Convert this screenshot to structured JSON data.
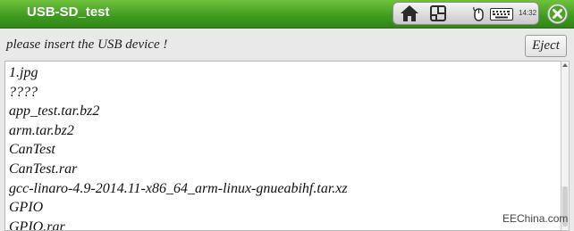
{
  "window": {
    "title": "USB-SD_test"
  },
  "tray": {
    "icons": [
      "home-icon",
      "window-switch-icon",
      "mouse-icon",
      "keyboard-icon"
    ],
    "clock": "14:32"
  },
  "prompt": "please insert the USB device !",
  "eject_label": "Eject",
  "files": [
    "1.jpg",
    "????",
    "app_test.tar.bz2",
    "arm.tar.bz2",
    "CanTest",
    "CanTest.rar",
    "gcc-linaro-4.9-2014.11-x86_64_arm-linux-gnueabihf.tar.xz",
    "GPIO",
    "GPIO.rar"
  ],
  "watermark": "EEChina.com",
  "colors": {
    "titlebar": "#3e9a1f",
    "close": "#4aa324"
  }
}
